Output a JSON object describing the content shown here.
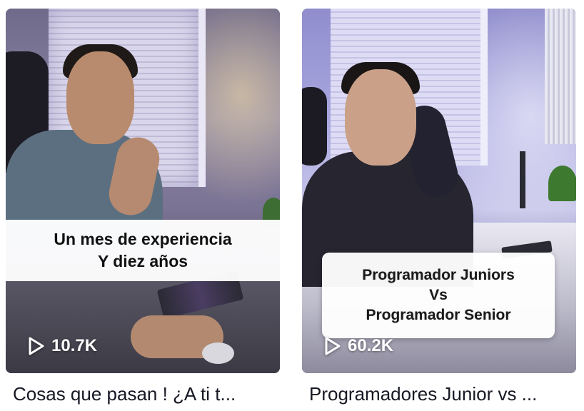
{
  "videos": [
    {
      "overlay_lines": [
        "Un mes de experiencia",
        "Y diez años"
      ],
      "views": "10.7K",
      "caption": "Cosas que pasan ! ¿A ti t..."
    },
    {
      "overlay_lines": [
        "Programador Juniors",
        "Vs",
        "Programador Senior"
      ],
      "views": "60.2K",
      "caption": "Programadores Junior vs ..."
    }
  ],
  "icons": {
    "views": "play-outline-icon"
  },
  "colors": {
    "text": "#161823",
    "overlay_text": "#111111",
    "views_text": "#ffffff"
  }
}
